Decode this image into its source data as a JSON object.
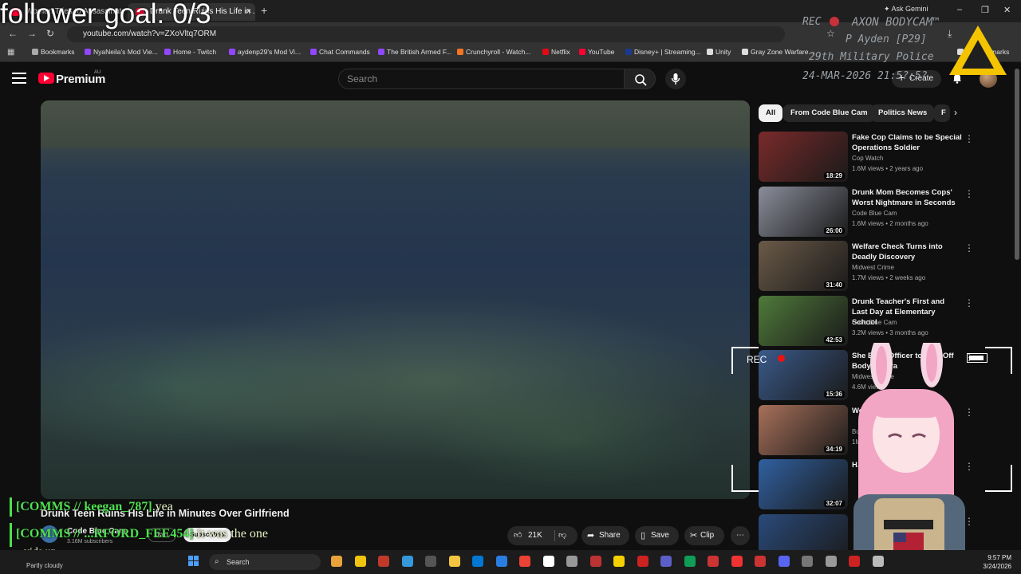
{
  "browser": {
    "tabs": [
      {
        "label": "Woman Tries to Assassinate C...",
        "active": false
      },
      {
        "label": "Drunk Teen Ruins His Life in ...",
        "active": true
      }
    ],
    "new_tab": "+",
    "ask_gemini": "Ask Gemini",
    "url": "youtube.com/watch?v=ZXoVltq7ORM",
    "bookmarks": [
      {
        "label": "Bookmarks",
        "color": "#aaaaaa"
      },
      {
        "label": "NyaNeila's Mod Vie...",
        "color": "#9146ff"
      },
      {
        "label": "Home - Twitch",
        "color": "#9146ff"
      },
      {
        "label": "aydenp29's Mod Vi...",
        "color": "#9146ff"
      },
      {
        "label": "Chat Commands",
        "color": "#9146ff"
      },
      {
        "label": "The British Armed F...",
        "color": "#9146ff"
      },
      {
        "label": "Crunchyroll - Watch...",
        "color": "#f47521"
      },
      {
        "label": "Netflix",
        "color": "#e50914"
      },
      {
        "label": "YouTube",
        "color": "#ff0033"
      },
      {
        "label": "Disney+ | Streaming...",
        "color": "#1a3a8f"
      },
      {
        "label": "Unity",
        "color": "#dddddd"
      },
      {
        "label": "Gray Zone Warfare...",
        "color": "#dddddd"
      },
      {
        "label": "All Bookmarks",
        "color": "#dddddd"
      }
    ]
  },
  "youtube": {
    "brand": "Premium",
    "region": "AU",
    "search_placeholder": "Search",
    "create_label": "Create",
    "video": {
      "title": "Drunk Teen Ruins His Life in Minutes Over Girlfriend",
      "channel": "Code Blue Cam",
      "subscribers": "3.16M subscribers",
      "join": "Join",
      "subscribe": "Subscribed",
      "likes": "21K",
      "share": "Share",
      "save": "Save",
      "clip": "Clip",
      "more": "⋯"
    },
    "chips": [
      "All",
      "From Code Blue Cam",
      "Politics News",
      "F"
    ],
    "recommendations": [
      {
        "title": "Fake Cop Claims to be Special Operations Soldier",
        "channel": "Cop Watch",
        "meta": "1.6M views • 2 years ago",
        "duration": "18:29",
        "thumb": "#7a2a2a"
      },
      {
        "title": "Drunk Mom Becomes Cops' Worst Nightmare in Seconds",
        "channel": "Code Blue Cam",
        "meta": "1.6M views • 2 months ago",
        "duration": "26:00",
        "thumb": "#8a8d9a"
      },
      {
        "title": "Welfare Check Turns into Deadly Discovery",
        "channel": "Midwest Crime",
        "meta": "1.7M views • 2 weeks ago",
        "duration": "31:40",
        "thumb": "#6b5a48"
      },
      {
        "title": "Drunk Teacher's First and Last Day at Elementary School",
        "channel": "Code Blue Cam",
        "meta": "3.2M views • 3 months ago",
        "duration": "42:53",
        "thumb": "#4f7a3a"
      },
      {
        "title": "She Begs Officer to Turn Off Bodycamera",
        "channel": "Midwest Crime",
        "meta": "4.6M views",
        "duration": "15:36",
        "thumb": "#3a5a8a"
      },
      {
        "title": "Wo... ...eg Du...",
        "channel": "Bod...",
        "meta": "1M...",
        "duration": "34:19",
        "thumb": "#a8705a"
      },
      {
        "title": "H... ...ed",
        "channel": "",
        "meta": "",
        "duration": "32:07",
        "thumb": "#3060a0"
      },
      {
        "title": "",
        "channel": "",
        "meta": "",
        "duration": "",
        "thumb": "#2a4a7a"
      }
    ]
  },
  "overlay": {
    "goal": "follower goal: 0/3",
    "rec": "REC",
    "axon": "AXON BODYCAM™",
    "officer": "P Ayden [P29]",
    "unit": "29th Military Police",
    "datetime": "24-MAR-2026 21:5?:5?",
    "cam_rec": "REC",
    "chat": [
      {
        "prefix": "[COMMS // keegan_787]",
        "text": "yea"
      },
      {
        "prefix": "[COMMS // ...RFORD_FEE454]",
        "text": "It was the one"
      }
    ],
    "chat_cont": "vids up"
  },
  "taskbar": {
    "weather": "Partly cloudy",
    "search": "Search",
    "time": "9:57 PM",
    "date": "3/24/2026",
    "icons": [
      "#e8a33a",
      "#f1c40f",
      "#c0392b",
      "#3498db",
      "#555555",
      "#f5c542",
      "#0078d4",
      "#2a7ee0",
      "#ea4335",
      "#ffffff",
      "#999999",
      "#b33",
      "#f5d000",
      "#c22",
      "#5b5fc7",
      "#0f9d58",
      "#c33",
      "#e33",
      "#c33",
      "#5865f2",
      "#777",
      "#999",
      "#c22",
      "#bbbbbb"
    ]
  }
}
